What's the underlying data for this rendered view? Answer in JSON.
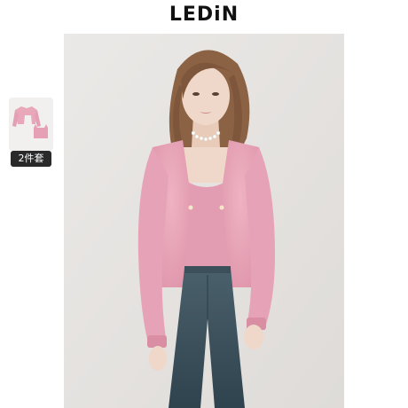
{
  "header": {
    "brand": "LEDiN"
  },
  "gallery": {
    "thumbnails": [
      {
        "label": "2件套",
        "selected": true
      }
    ]
  },
  "product": {
    "colors": {
      "sweater": "#e9a7ba",
      "sweater_dark": "#d98ea4",
      "jeans": "#3f5561",
      "hair": "#8c6244",
      "skin": "#efd8c9",
      "backdrop": "#e7e5e3"
    }
  }
}
